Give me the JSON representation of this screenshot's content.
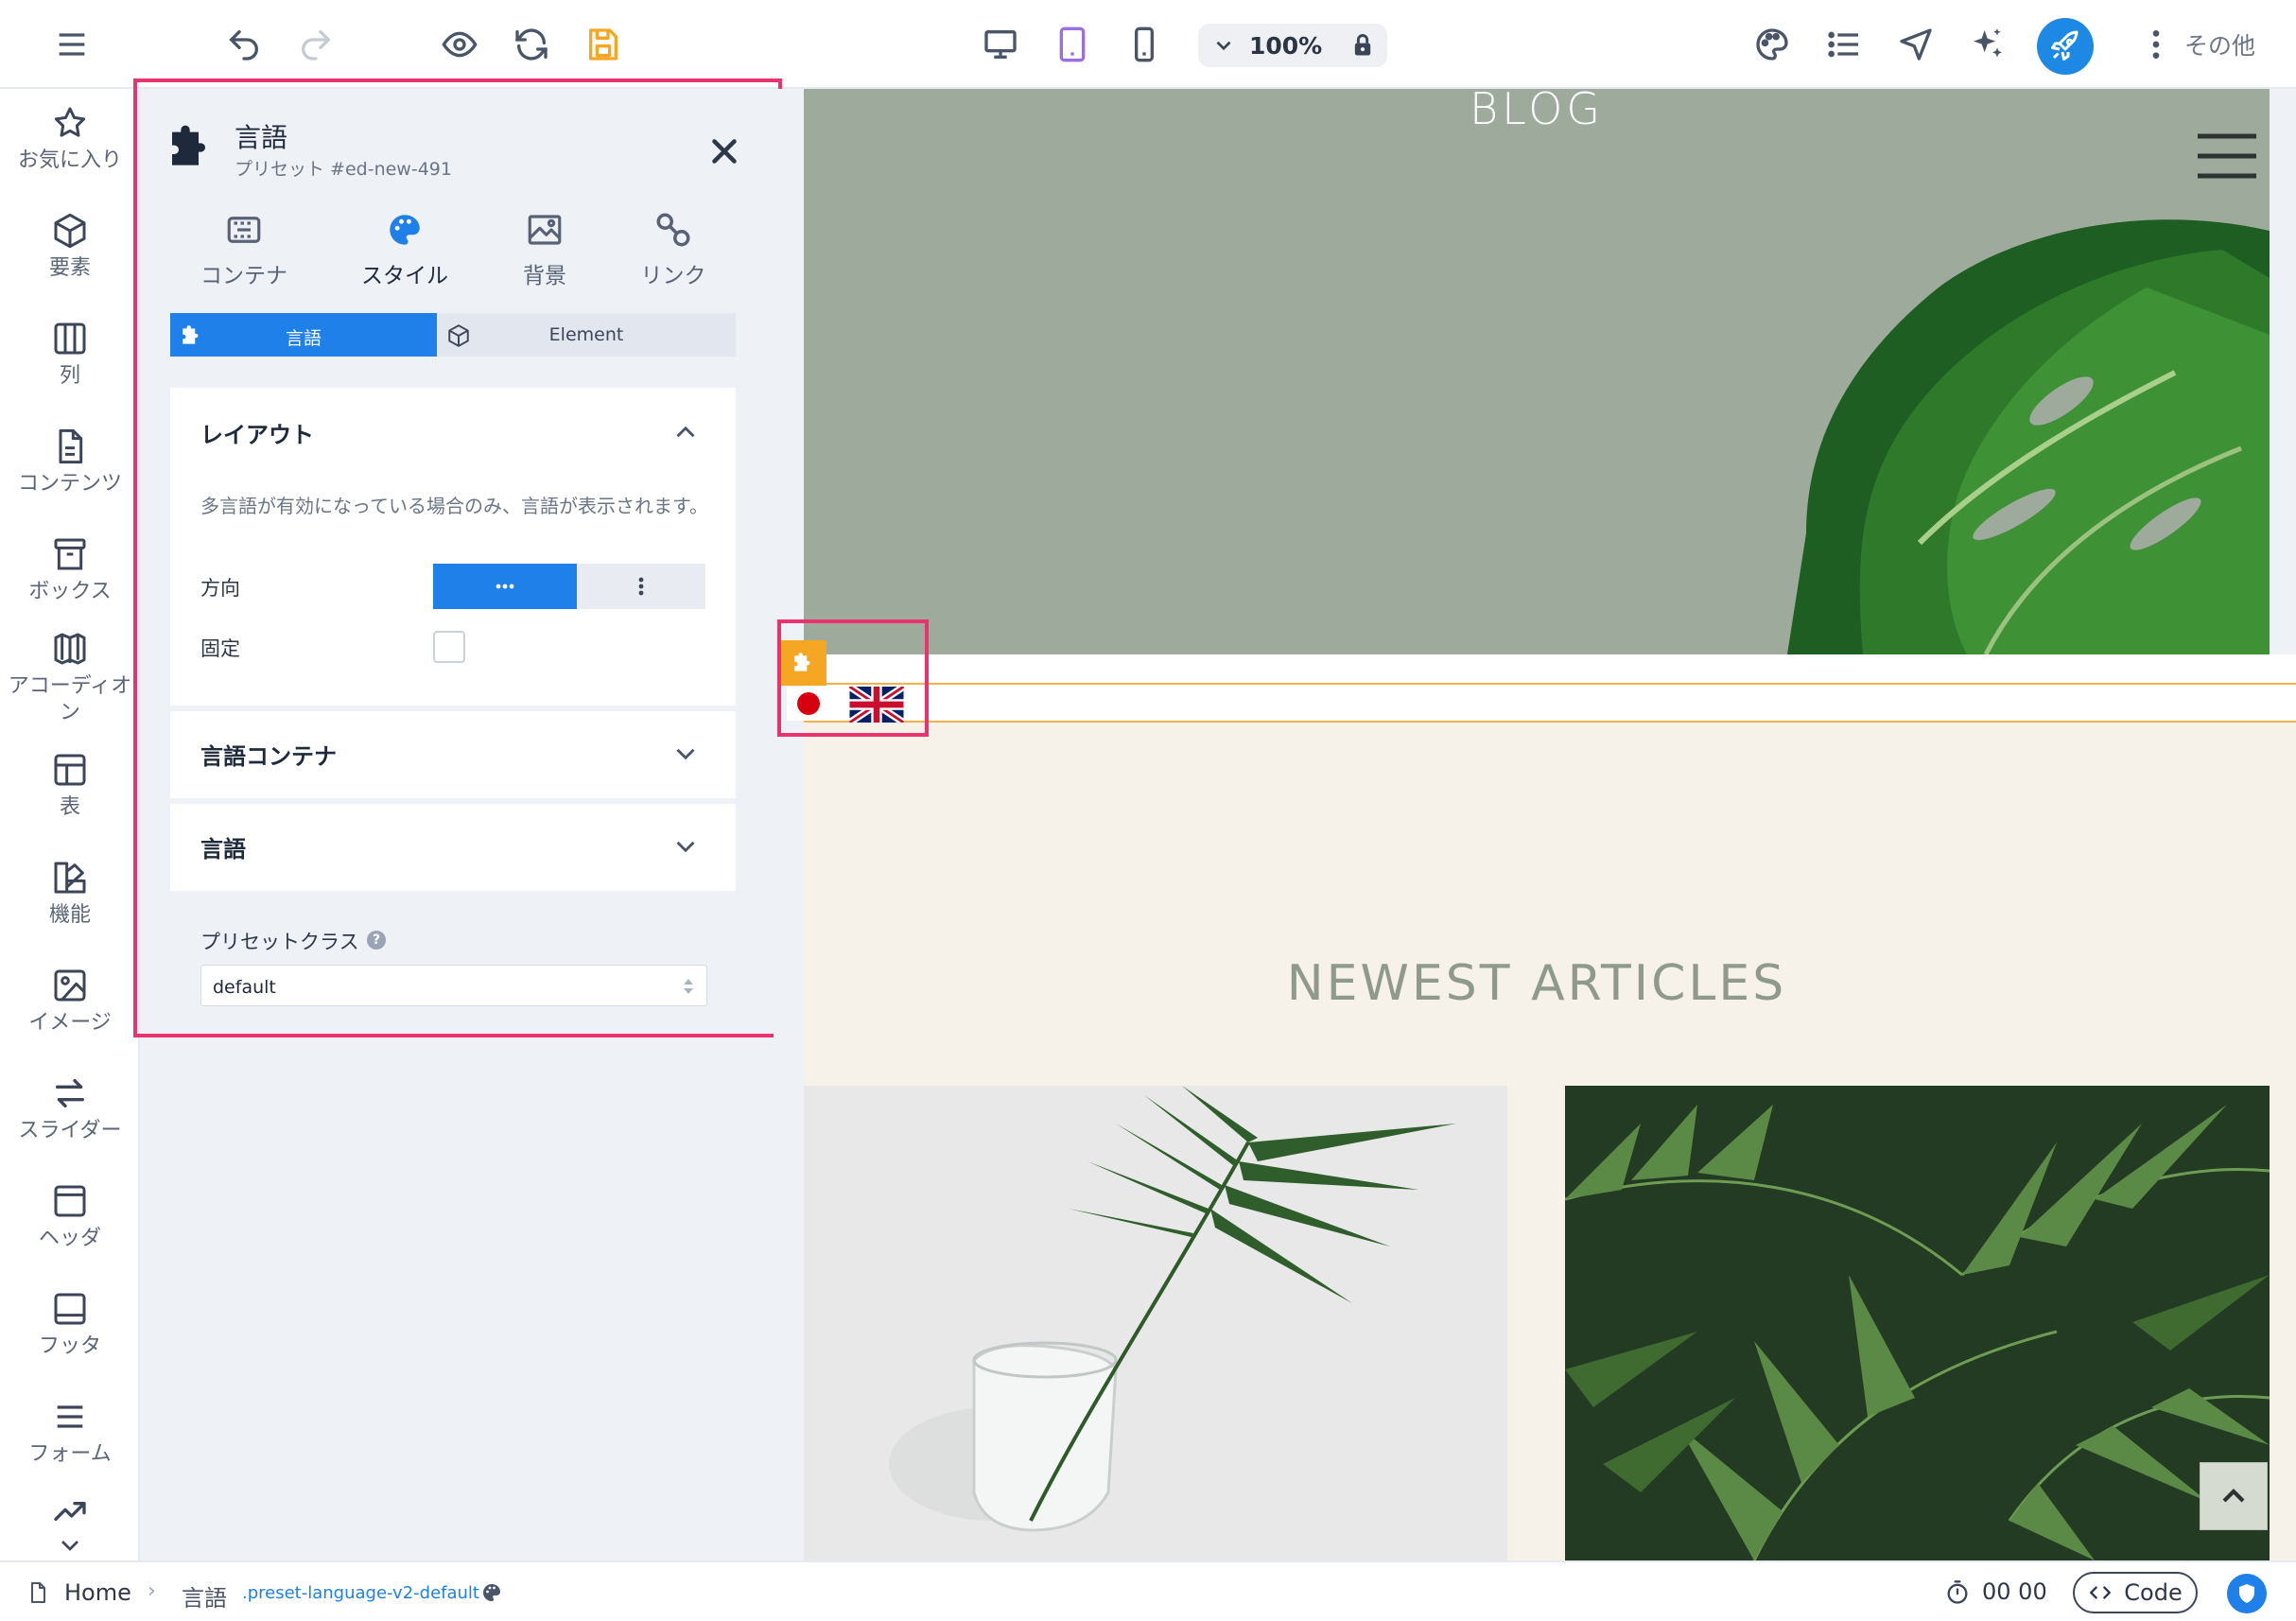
{
  "toolbar": {
    "zoom": "100%",
    "more_label": "その他"
  },
  "sidebar": {
    "items": [
      {
        "label": "お気に入り",
        "icon": "star-icon"
      },
      {
        "label": "要素",
        "icon": "cube-icon"
      },
      {
        "label": "列",
        "icon": "columns-icon"
      },
      {
        "label": "コンテンツ",
        "icon": "document-icon"
      },
      {
        "label": "ボックス",
        "icon": "archive-icon"
      },
      {
        "label": "アコーディオン",
        "icon": "accordion-icon"
      },
      {
        "label": "表",
        "icon": "table-icon"
      },
      {
        "label": "機能",
        "icon": "features-icon"
      },
      {
        "label": "イメージ",
        "icon": "image-icon"
      },
      {
        "label": "スライダー",
        "icon": "arrows-icon"
      },
      {
        "label": "ヘッダ",
        "icon": "header-icon"
      },
      {
        "label": "フッタ",
        "icon": "footer-icon"
      },
      {
        "label": "フォーム",
        "icon": "form-icon"
      }
    ]
  },
  "panel": {
    "title": "言語",
    "subtitle": "プリセット #ed-new-491",
    "tabs": [
      {
        "label": "コンテナ",
        "icon": "container-icon"
      },
      {
        "label": "スタイル",
        "icon": "palette-icon"
      },
      {
        "label": "背景",
        "icon": "image-icon"
      },
      {
        "label": "リンク",
        "icon": "link-icon"
      }
    ],
    "subtabs": {
      "language": "言語",
      "element": "Element"
    },
    "layout": {
      "title": "レイアウト",
      "description": "多言語が有効になっている場合のみ、言語が表示されます。",
      "direction_label": "方向",
      "fixed_label": "固定"
    },
    "container_section": "言語コンテナ",
    "language_section": "言語",
    "preset_class_label": "プリセットクラス",
    "preset_help": "?",
    "preset_class_value": "default"
  },
  "canvas": {
    "hero_title": "BLOG",
    "articles_title": "NEWEST ARTICLES"
  },
  "bottombar": {
    "home": "Home",
    "separator": "›",
    "element": "言語",
    "class": ".preset-language-v2-default",
    "timer": "00 00",
    "code": "Code"
  },
  "colors": {
    "accent": "#1e80e8",
    "highlight": "#e8336f",
    "save": "#f5a623",
    "hero_bg": "#9daa9c"
  }
}
